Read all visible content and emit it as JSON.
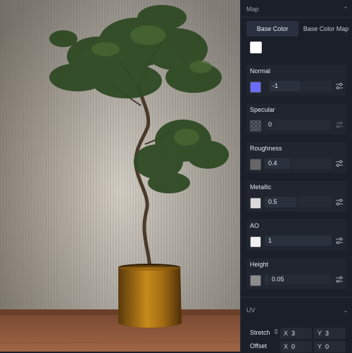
{
  "panel": {
    "map_section_title": "Map",
    "tabs": [
      "Base Color",
      "Base Color Map"
    ],
    "base_color_hex": "#ffffff",
    "properties": [
      {
        "label": "Normal",
        "value": "-1",
        "swatch": "#6b6bf5",
        "icon": "sliders-icon"
      },
      {
        "label": "Specular",
        "value": "0",
        "swatch": "checker",
        "icon": "sliders-icon"
      },
      {
        "label": "Roughness",
        "value": "0.4",
        "swatch": "#666666",
        "icon": "sliders-icon"
      },
      {
        "label": "Metallic",
        "value": "0.5",
        "swatch": "#d9d9d9",
        "icon": "sliders-icon"
      },
      {
        "label": "AO",
        "value": "1",
        "swatch": "#efefef",
        "icon": "sliders-icon"
      },
      {
        "label": "Height",
        "value": "0.05",
        "swatch": "#8c8c8c",
        "icon": "sliders-icon"
      }
    ],
    "uv_section_title": "UV",
    "uv": {
      "stretch_label": "Stretch",
      "offset_label": "Offset",
      "stretch_x": "3",
      "stretch_y": "3",
      "offset_x": "0",
      "offset_y": "0",
      "x_axis": "X",
      "y_axis": "Y"
    }
  }
}
